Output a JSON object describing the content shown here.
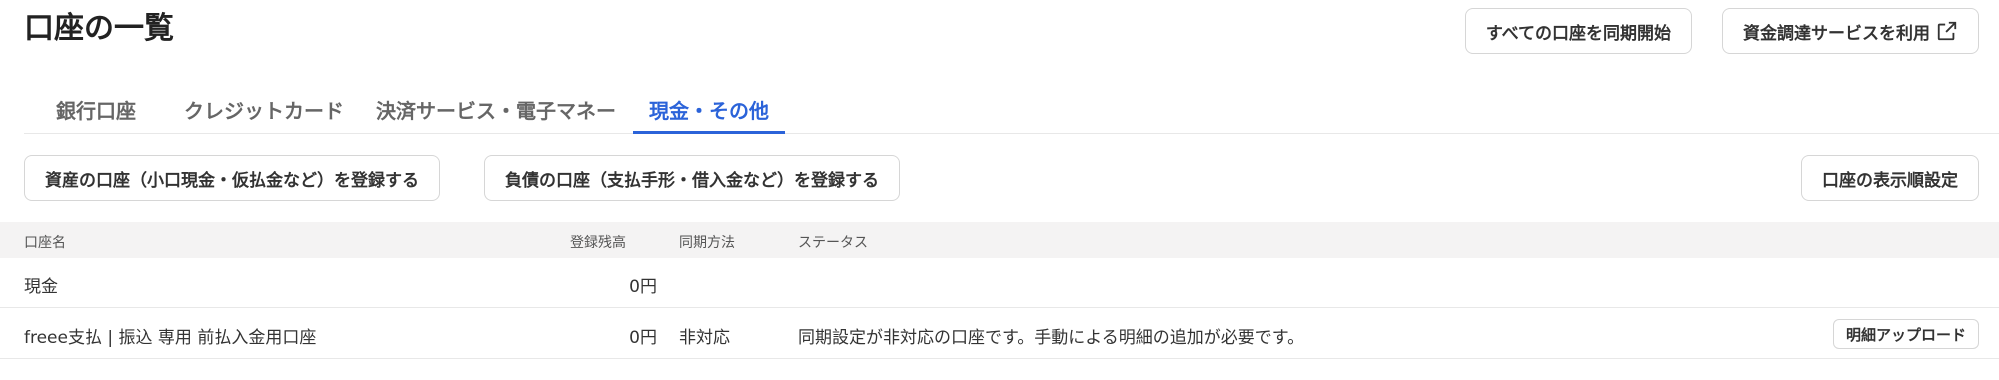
{
  "page": {
    "title": "口座の一覧"
  },
  "header_actions": {
    "sync_all": "すべての口座を同期開始",
    "funding": "資金調達サービスを利用",
    "funding_icon": "external-link-icon"
  },
  "tabs": [
    {
      "label": "銀行口座",
      "active": false
    },
    {
      "label": "クレジットカード",
      "active": false
    },
    {
      "label": "決済サービス・電子マネー",
      "active": false
    },
    {
      "label": "現金・その他",
      "active": true
    }
  ],
  "actions": {
    "register_asset": "資産の口座（小口現金・仮払金など）を登録する",
    "register_liability": "負債の口座（支払手形・借入金など）を登録する",
    "display_order": "口座の表示順設定"
  },
  "table": {
    "headers": {
      "name": "口座名",
      "balance": "登録残高",
      "sync": "同期方法",
      "status": "ステータス"
    },
    "rows": [
      {
        "name": "現金",
        "balance": "0円",
        "sync": "",
        "status": "",
        "action": ""
      },
      {
        "name": "freee支払 | 振込 専用 前払入金用口座",
        "balance": "0円",
        "sync": "非対応",
        "status": "同期設定が非対応の口座です。手動による明細の追加が必要です。",
        "action": "明細アップロード"
      }
    ]
  },
  "colors": {
    "accent": "#2b63d9",
    "header_bg": "#f4f3f3",
    "border": "#d6d6d6"
  }
}
